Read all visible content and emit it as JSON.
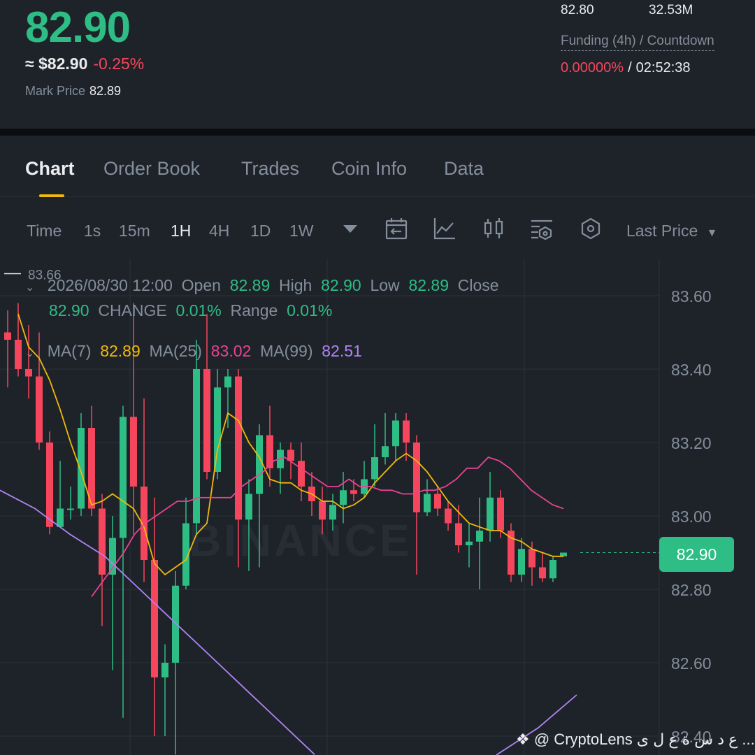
{
  "header": {
    "price": "82.90",
    "usd_value": "≈ $82.90",
    "change_pct": "-0.25%",
    "mark_price_label": "Mark Price",
    "mark_price_value": "82.89",
    "stat_low": "82.80",
    "stat_volume": "32.53M",
    "funding_label": "Funding (4h) / Countdown",
    "funding_rate": "0.00000%",
    "funding_sep": "/",
    "countdown": "02:52:38"
  },
  "tabs": [
    {
      "label": "Chart",
      "active": true
    },
    {
      "label": "Order Book",
      "active": false
    },
    {
      "label": "Trades",
      "active": false
    },
    {
      "label": "Coin Info",
      "active": false
    },
    {
      "label": "Data",
      "active": false
    }
  ],
  "toolbar": {
    "intervals": [
      "Time",
      "1s",
      "15m",
      "1H",
      "4H",
      "1D",
      "1W"
    ],
    "active_interval": "1H",
    "price_type": "Last Price",
    "icons": [
      "calendar-icon",
      "indicator-icon",
      "candle-style-icon",
      "settings-icon",
      "drawing-icon"
    ]
  },
  "legend": {
    "date": "2026/08/30 12:00",
    "open_label": "Open",
    "open": "82.89",
    "high_label": "High",
    "high": "82.90",
    "low_label": "Low",
    "low": "82.89",
    "close_label": "Close",
    "close": "82.90",
    "change_label": "CHANGE",
    "change": "0.01%",
    "range_label": "Range",
    "range": "0.01%",
    "ma7_label": "MA(7)",
    "ma7": "82.89",
    "ma25_label": "MA(25)",
    "ma25": "83.02",
    "ma99_label": "MA(99)",
    "ma99": "82.51"
  },
  "watermark": "BINANCE",
  "current_price_tag": "82.90",
  "credit": "@ CryptoLens ع د س ة ع ل ى ...",
  "colors": {
    "up": "#2ebd85",
    "down": "#f6465d",
    "ma7": "#f0b90b",
    "ma25": "#e84393",
    "ma99": "#b084f5",
    "accent": "#f0b90b"
  },
  "chart_data": {
    "type": "candlestick",
    "y_axis_ticks": [
      "83.60",
      "83.40",
      "83.20",
      "83.00",
      "82.80",
      "82.60",
      "82.40"
    ],
    "max_label": "83.66",
    "ylim": [
      82.35,
      83.7
    ],
    "candles": [
      [
        83.5,
        83.48,
        83.56,
        83.35
      ],
      [
        83.48,
        83.4,
        83.58,
        83.38
      ],
      [
        83.4,
        83.38,
        83.52,
        83.32
      ],
      [
        83.38,
        83.2,
        83.5,
        83.18
      ],
      [
        83.2,
        82.97,
        83.23,
        82.95
      ],
      [
        82.97,
        83.02,
        83.15,
        82.98
      ],
      [
        83.02,
        83.02,
        83.08,
        82.99
      ],
      [
        83.02,
        83.24,
        83.28,
        83.0
      ],
      [
        83.24,
        83.02,
        83.3,
        83.0
      ],
      [
        83.02,
        82.84,
        83.06,
        82.7
      ],
      [
        82.84,
        82.94,
        83.0,
        82.58
      ],
      [
        82.94,
        83.27,
        83.3,
        82.45
      ],
      [
        83.27,
        83.08,
        83.58,
        82.95
      ],
      [
        83.08,
        82.88,
        83.32,
        82.82
      ],
      [
        82.88,
        82.56,
        83.05,
        82.4
      ],
      [
        82.56,
        82.6,
        82.65,
        82.4
      ],
      [
        82.6,
        82.81,
        82.85,
        82.35
      ],
      [
        82.81,
        82.98,
        83.05,
        82.8
      ],
      [
        82.98,
        83.4,
        83.48,
        82.95
      ],
      [
        83.4,
        83.12,
        83.55,
        83.1
      ],
      [
        83.12,
        83.35,
        83.4,
        83.1
      ],
      [
        83.35,
        83.38,
        83.4,
        83.24
      ],
      [
        83.38,
        82.99,
        83.4,
        82.86
      ],
      [
        82.99,
        83.06,
        83.1,
        82.85
      ],
      [
        83.06,
        83.22,
        83.25,
        82.86
      ],
      [
        83.22,
        83.13,
        83.3,
        83.08
      ],
      [
        83.13,
        83.18,
        83.2,
        83.06
      ],
      [
        83.18,
        83.15,
        83.2,
        83.1
      ],
      [
        83.15,
        83.08,
        83.2,
        83.04
      ],
      [
        83.08,
        83.04,
        83.12,
        83.0
      ],
      [
        83.04,
        82.99,
        83.08,
        82.95
      ],
      [
        82.99,
        83.03,
        83.06,
        82.96
      ],
      [
        83.03,
        83.07,
        83.12,
        82.98
      ],
      [
        83.07,
        83.06,
        83.1,
        83.04
      ],
      [
        83.06,
        83.1,
        83.15,
        83.05
      ],
      [
        83.1,
        83.16,
        83.25,
        83.08
      ],
      [
        83.16,
        83.19,
        83.28,
        83.14
      ],
      [
        83.19,
        83.26,
        83.28,
        83.15
      ],
      [
        83.26,
        83.2,
        83.28,
        83.15
      ],
      [
        83.2,
        83.01,
        83.22,
        82.84
      ],
      [
        83.01,
        83.06,
        83.1,
        83.0
      ],
      [
        83.06,
        83.02,
        83.08,
        83.0
      ],
      [
        83.02,
        82.98,
        83.04,
        82.96
      ],
      [
        82.98,
        82.92,
        83.03,
        82.9
      ],
      [
        82.92,
        82.93,
        82.98,
        82.86
      ],
      [
        82.93,
        82.96,
        83.05,
        82.8
      ],
      [
        82.96,
        83.05,
        83.12,
        82.93
      ],
      [
        83.05,
        82.96,
        83.07,
        82.94
      ],
      [
        82.96,
        82.84,
        82.98,
        82.82
      ],
      [
        82.84,
        82.91,
        82.94,
        82.82
      ],
      [
        82.91,
        82.86,
        82.93,
        82.81
      ],
      [
        82.86,
        82.83,
        82.9,
        82.82
      ],
      [
        82.83,
        82.88,
        82.89,
        82.82
      ],
      [
        82.89,
        82.9,
        82.9,
        82.89
      ]
    ],
    "ma7": [
      83.55,
      83.46,
      83.43,
      83.37,
      83.29,
      83.2,
      83.12,
      83.03,
      83.04,
      83.06,
      83.04,
      83.02,
      82.97,
      82.87,
      82.84,
      82.86,
      82.88,
      82.95,
      82.98,
      83.18,
      83.28,
      83.26,
      83.2,
      83.16,
      83.1,
      83.09,
      83.09,
      83.07,
      83.06,
      83.04,
      83.04,
      83.02,
      83.03,
      83.05,
      83.09,
      83.12,
      83.15,
      83.17,
      83.15,
      83.12,
      83.08,
      83.04,
      83.01,
      82.98,
      82.97,
      82.96,
      82.96,
      82.94,
      82.93,
      82.91,
      82.9,
      82.89,
      82.89
    ],
    "ma25": [
      82.78,
      82.82,
      82.86,
      82.9,
      82.95,
      82.98,
      83.0,
      83.02,
      83.04,
      83.04,
      83.05,
      83.05,
      83.05,
      83.05,
      83.08,
      83.1,
      83.12,
      83.15,
      83.16,
      83.14,
      83.12,
      83.1,
      83.08,
      83.08,
      83.1,
      83.08,
      83.08,
      83.07,
      83.07,
      83.06,
      83.06,
      83.07,
      83.07,
      83.08,
      83.1,
      83.13,
      83.13,
      83.16,
      83.15,
      83.13,
      83.1,
      83.07,
      83.05,
      83.03,
      83.02
    ],
    "ma99": [
      83.07,
      83.02,
      82.95,
      82.89,
      82.8,
      82.71,
      82.62,
      82.53,
      82.44,
      82.35
    ]
  }
}
